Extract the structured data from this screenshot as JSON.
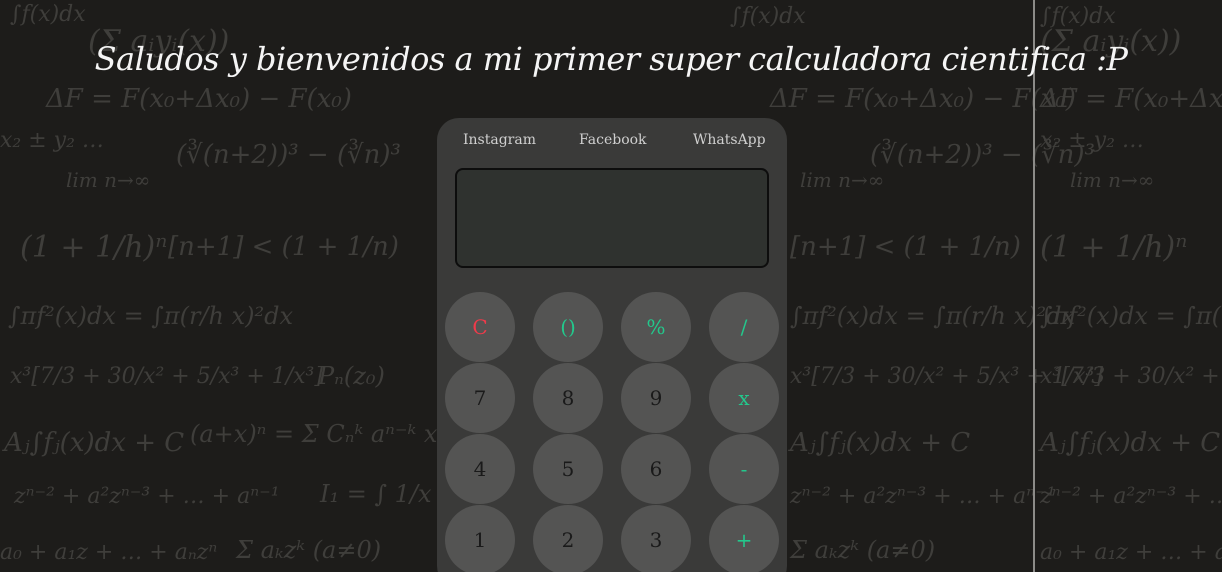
{
  "page": {
    "title": "Saludos y bienvenidos a mi primer super calculadora cientifica :P"
  },
  "background": {
    "formulas": [
      "∫f(x)dx",
      "(Σ aᵢyᵢ(x))",
      "ΔF = F(x₀+Δx₀) − F(x₀)",
      "lim n→∞",
      "(∛(n+2))³ − (∛n)³",
      "(1 + 1/h)ⁿ",
      "[n+1] < (1 + 1/n)",
      "∫πf²(x)dx = ∫π(r/h x)²dx",
      "Pₙ(z₀)",
      "x³[7/3 + 30/x² + 5/x³ + 1/x³]",
      "Aⱼ∫fⱼ(x)dx + C",
      "(a+x)ⁿ = Σ Cₙᵏ aⁿ⁻ᵏ xᵏ",
      "zⁿ⁻² + a²zⁿ⁻³ + … + aⁿ⁻¹",
      "a₀ + a₁z + … + aₙzⁿ",
      "Σ aₖzᵏ (a≠0)",
      "x₂ ± y₂ …",
      "I₁ = ∫ 1/x"
    ]
  },
  "calculator": {
    "links": [
      {
        "label": "Instagram"
      },
      {
        "label": "Facebook"
      },
      {
        "label": "WhatsApp"
      }
    ],
    "display_value": "",
    "keys": [
      {
        "label": "C",
        "name": "clear-button",
        "color": "red"
      },
      {
        "label": "()",
        "name": "parentheses-button",
        "color": "green"
      },
      {
        "label": "%",
        "name": "percent-button",
        "color": "green"
      },
      {
        "label": "/",
        "name": "divide-button",
        "color": "green"
      },
      {
        "label": "7",
        "name": "digit-7-button",
        "color": "dark"
      },
      {
        "label": "8",
        "name": "digit-8-button",
        "color": "dark"
      },
      {
        "label": "9",
        "name": "digit-9-button",
        "color": "dark"
      },
      {
        "label": "x",
        "name": "multiply-button",
        "color": "green"
      },
      {
        "label": "4",
        "name": "digit-4-button",
        "color": "dark"
      },
      {
        "label": "5",
        "name": "digit-5-button",
        "color": "dark"
      },
      {
        "label": "6",
        "name": "digit-6-button",
        "color": "dark"
      },
      {
        "label": "-",
        "name": "subtract-button",
        "color": "green"
      },
      {
        "label": "1",
        "name": "digit-1-button",
        "color": "dark"
      },
      {
        "label": "2",
        "name": "digit-2-button",
        "color": "dark"
      },
      {
        "label": "3",
        "name": "digit-3-button",
        "color": "dark"
      },
      {
        "label": "+",
        "name": "add-button",
        "color": "green"
      }
    ]
  },
  "colors": {
    "background": "#1d1c1a",
    "calculator_body": "#3a3a39",
    "key": "#545453",
    "accent_red": "#f03a4a",
    "accent_green": "#23c88c",
    "screen": "#2f322f"
  }
}
